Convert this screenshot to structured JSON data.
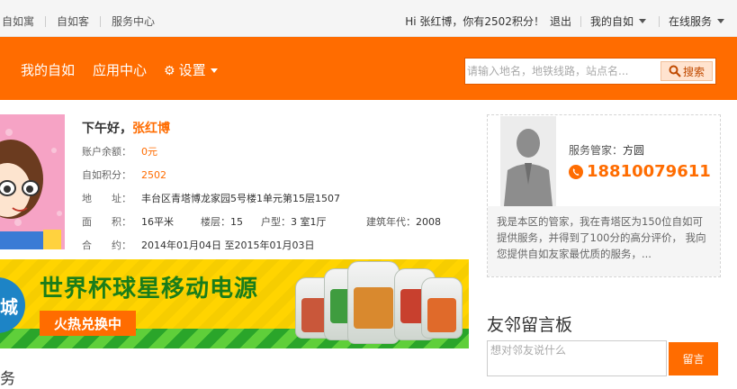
{
  "topbar": {
    "links": [
      "自如寓",
      "自如客",
      "服务中心"
    ],
    "greeting": "Hi 张红博，你有2502积分！",
    "logout": "退出",
    "my_ziroom": "我的自如",
    "online_service": "在线服务"
  },
  "nav": {
    "items": [
      "我的自如",
      "应用中心",
      "设置"
    ],
    "search_placeholder": "请输入地名，地铁线路，站点名...",
    "search_button": "搜索"
  },
  "profile": {
    "greeting_prefix": "下午好，",
    "name": "张红博",
    "balance_label": "账户余额：",
    "balance": "0元",
    "points_label": "自如积分：",
    "points": "2502",
    "address_label": "地　　址：",
    "address": "丰台区青塔博龙家园5号楼1单元第15层1507",
    "area_label": "面　　积：",
    "area": "16平米",
    "floor_label": "楼层：",
    "floor": "15",
    "layout_label": "户型：",
    "layout": "3 室1厅",
    "year_label": "建筑年代：",
    "year": "2008",
    "contract_label": "合　　约：",
    "contract": "2014年01月04日 至2015年01月03日"
  },
  "banner": {
    "circle_text": "城",
    "headline": "世界杯球星移动电源",
    "cta": "火热兑换中"
  },
  "service_title": "务",
  "manager": {
    "label": "服务管家：",
    "name": "方圆",
    "phone": "18810079611",
    "description": "我是本区的管家，我在青塔区为150位自如可提供服务，并得到了100分的高分评价， 我向您提供自如友家最优质的服务，..."
  },
  "board": {
    "title": "友邻留言板",
    "placeholder": "想对邻友说什么",
    "button": "留言"
  },
  "colors": {
    "accent": "#ff6c00",
    "banner_green": "#1a7d1a",
    "banner_yellow": "#ffd400"
  }
}
